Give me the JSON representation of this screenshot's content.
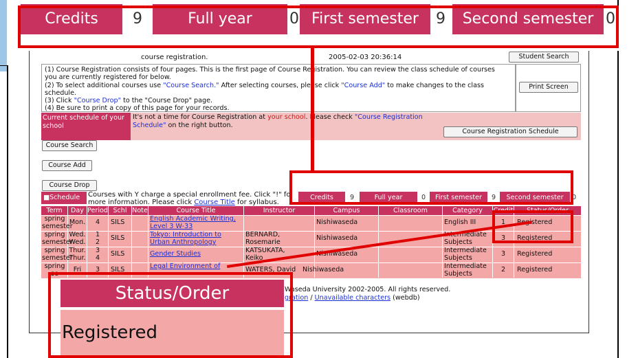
{
  "zoom_top": {
    "cells": [
      {
        "label": "Credits",
        "type": "label"
      },
      {
        "label": "9",
        "type": "value"
      },
      {
        "label": "Full year",
        "type": "label"
      },
      {
        "label": "0",
        "type": "value"
      },
      {
        "label": "First semester",
        "type": "label"
      },
      {
        "label": "9",
        "type": "value"
      },
      {
        "label": "Second semester",
        "type": "label"
      },
      {
        "label": "0",
        "type": "value"
      }
    ]
  },
  "header": {
    "registration_label": "course registration.",
    "timestamp": "2005-02-03 20:36:14",
    "student_search": "Student Search"
  },
  "instructions": {
    "l1": "(1) Course Registration consists of four pages. This is the first page of Course Registration. You can review the class schedule of courses",
    "l2": "you are currently registered for below.",
    "l3a": "(2) To select additional courses use ",
    "l3b": "\"Course Search.\"",
    "l3c": " After selecting courses, please click ",
    "l3d": "\"Course Add\"",
    "l3e": " to make changes to the class",
    "l4": "schedule.",
    "l5a": "(3) Click ",
    "l5b": "\"Course Drop\"",
    "l5c": " to the \"Course Drop\" page.",
    "l6": "(4) Be sure to print a copy of this page for your records.",
    "print_screen": "Print Screen"
  },
  "current": {
    "header_l1": "Current schedule of your",
    "header_l2": "school",
    "msg_a": "It's not a time for Course Registration at ",
    "msg_b": "your school",
    "msg_c": ". Please check ",
    "msg_d": "\"Course Registration",
    "msg_e": "Schedule\"",
    "msg_f": " on the right button.",
    "schedule_button": "Course Registration Schedule"
  },
  "buttons": {
    "course_search": "Course Search",
    "course_add": "Course Add",
    "course_drop": "Course Drop"
  },
  "schedule": {
    "label": "■Schedule",
    "note_l1": "Courses with Y charge a special enrollment fee. Click \"!\" fo",
    "note_l2a": "more information. Please click ",
    "note_l2b": "Course Title",
    "note_l2c": " for syllabus."
  },
  "overlay_bar": {
    "cells": [
      {
        "label": "Credits",
        "type": "label"
      },
      {
        "label": "9",
        "type": "value"
      },
      {
        "label": "Full year",
        "type": "label"
      },
      {
        "label": "0",
        "type": "value"
      },
      {
        "label": "First semester",
        "type": "label"
      },
      {
        "label": "9",
        "type": "value"
      },
      {
        "label": "Second semester",
        "type": "label"
      },
      {
        "label": "0",
        "type": "value"
      }
    ]
  },
  "table": {
    "columns": [
      "Term",
      "Day",
      "Period",
      "Schl",
      "Note",
      "Course Title",
      "Instructor",
      "Campus",
      "Classroom",
      "Category",
      "Credit",
      "Status/Order"
    ],
    "rows": [
      {
        "term1": "spring",
        "term2": "semester",
        "day1": "Mon.",
        "day2": "",
        "per1": "4",
        "per2": "",
        "schl": "SILS",
        "title1": "English Academic Writing,",
        "title2": "Level 3 W-33",
        "instr1": "",
        "instr2": "",
        "campus": "Nishiwaseda",
        "cat1": "English III",
        "cat2": "",
        "credit": "1",
        "status": "Registered"
      },
      {
        "term1": "spring",
        "term2": "semester",
        "day1": "Wed.",
        "day2": "Wed.",
        "per1": "1",
        "per2": "2",
        "schl": "SILS",
        "title1": "Tokyo: Introduction to",
        "title2": "Urban Anthropology",
        "instr1": "BERNARD,",
        "instr2": "Rosemarie",
        "campus": "Nishiwaseda",
        "cat1": "Intermediate",
        "cat2": "Subjects",
        "credit": "3",
        "status": "Registered"
      },
      {
        "term1": "spring",
        "term2": "semester",
        "day1": "Thur.",
        "day2": "Thur.",
        "per1": "3",
        "per2": "4",
        "schl": "SILS",
        "title1": "Gender Studies",
        "title2": "",
        "instr1": "KATSUKATA,",
        "instr2": "Keiko",
        "campus": "Nishiwaseda",
        "cat1": "Intermediate",
        "cat2": "Subjects",
        "credit": "3",
        "status": "Registered"
      },
      {
        "term1": "spring",
        "term2": "se",
        "day1": "Fri",
        "day2": "",
        "per1": "3",
        "per2": "",
        "schl": "SILS",
        "title1": "Legal Environment of",
        "title2": "",
        "instr1": "WATERS, David",
        "instr2": "",
        "campus": "Nishiwaseda",
        "cat1": "Intermediate",
        "cat2": "Subjects",
        "credit": "2",
        "status": "Registered"
      }
    ]
  },
  "footer": {
    "copyright": "Waseda University 2002-2005. All rights reserved.",
    "link1": "gration",
    "sep": " / ",
    "link2": "Unavailable characters",
    "suffix": " (webdb)"
  },
  "zoom_status": {
    "header": "Status/Order",
    "value": "Registered"
  },
  "colors": {
    "accent": "#c8325f",
    "row_pink": "#f3a7a7",
    "highlight_red": "#e00000",
    "link_blue": "#1b2fd6"
  }
}
